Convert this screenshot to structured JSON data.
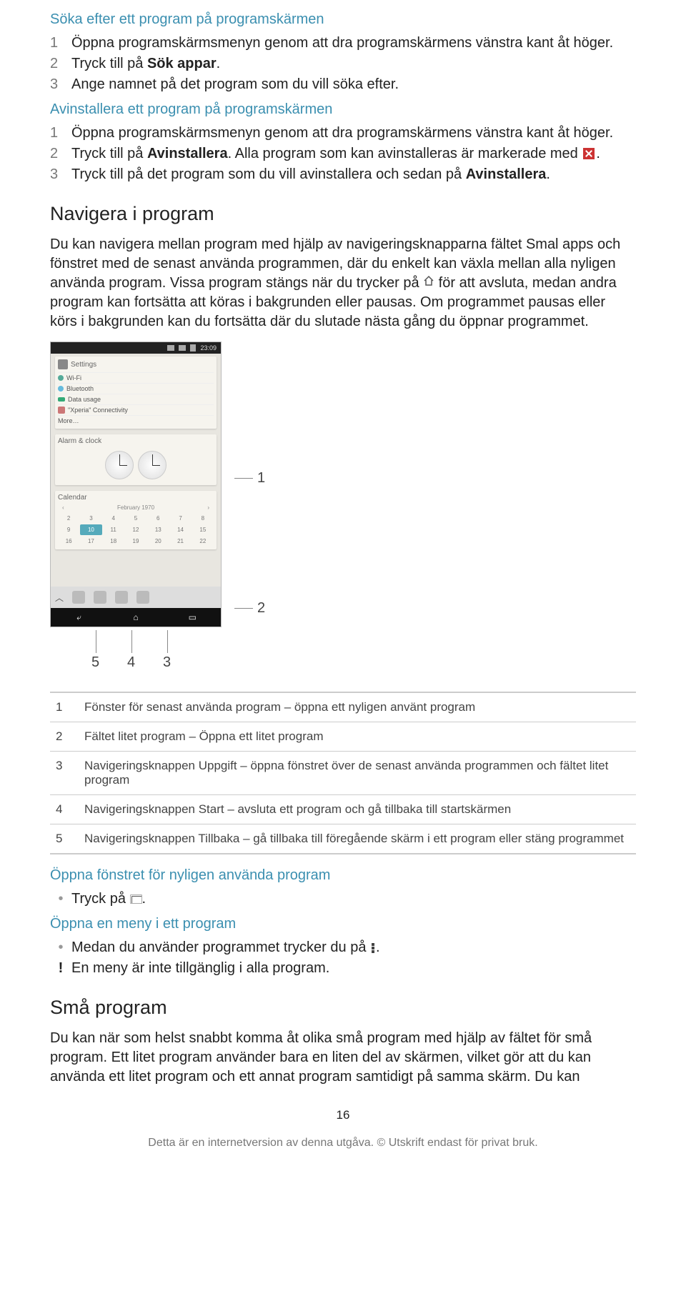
{
  "s1": {
    "title": "Söka efter ett program på programskärmen",
    "steps": [
      {
        "n": "1",
        "parts": [
          "Öppna programskärmsmenyn genom att dra programskärmens vänstra kant åt höger."
        ]
      },
      {
        "n": "2",
        "parts": [
          "Tryck till på "
        ],
        "bold": "Sök appar",
        "tail": "."
      },
      {
        "n": "3",
        "parts": [
          "Ange namnet på det program som du vill söka efter."
        ]
      }
    ]
  },
  "s2": {
    "title": "Avinstallera ett program på programskärmen",
    "steps": [
      {
        "n": "1",
        "parts": [
          "Öppna programskärmsmenyn genom att dra programskärmens vänstra kant åt höger."
        ]
      },
      {
        "n": "2",
        "parts": [
          "Tryck till på "
        ],
        "bold": "Avinstallera",
        "tail": ". Alla program som kan avinstalleras är markerade med ",
        "iconAfter": "x",
        "trail": "."
      },
      {
        "n": "3",
        "parts": [
          "Tryck till på det program som du vill avinstallera och sedan på "
        ],
        "bold": "Avinstallera",
        "tail": "."
      }
    ]
  },
  "nav": {
    "heading": "Navigera i program",
    "p_before": "Du kan navigera mellan program med hjälp av navigeringsknapparna fältet Smal apps och fönstret med de senast använda programmen, där du enkelt kan växla mellan alla nyligen använda program. Vissa program stängs när du trycker på ",
    "p_after": " för att avsluta, medan andra program kan fortsätta att köras i bakgrunden eller pausas. Om programmet pausas eller körs i bakgrunden kan du fortsätta där du slutade nästa gång du öppnar programmet."
  },
  "shot": {
    "time": "23:09",
    "settings": "Settings",
    "rows": {
      "wifi": "Wi-Fi",
      "bt": "Bluetooth",
      "data": "Data usage",
      "xc": "\"Xperia\" Connectivity",
      "more": "More…"
    },
    "alarm": "Alarm & clock",
    "cal": "Calendar",
    "month": "February 1970",
    "days": [
      "2",
      "3",
      "4",
      "5",
      "6",
      "7",
      "8",
      "9",
      "10",
      "11",
      "12",
      "13",
      "14",
      "15",
      "16",
      "17",
      "18",
      "19",
      "20",
      "21",
      "22"
    ],
    "callouts": {
      "c1": "1",
      "c2": "2",
      "c3": "3",
      "c4": "4",
      "c5": "5"
    }
  },
  "legend": [
    {
      "n": "1",
      "t": "Fönster för senast använda program – öppna ett nyligen använt program"
    },
    {
      "n": "2",
      "t": "Fältet litet program – Öppna ett litet program"
    },
    {
      "n": "3",
      "t": "Navigeringsknappen Uppgift – öppna fönstret över de senast använda programmen och fältet litet program"
    },
    {
      "n": "4",
      "t": "Navigeringsknappen Start – avsluta ett program och gå tillbaka till startskärmen"
    },
    {
      "n": "5",
      "t": "Navigeringsknappen Tillbaka – gå tillbaka till föregående skärm i ett program eller stäng programmet"
    }
  ],
  "open_recent": {
    "title": "Öppna fönstret för nyligen använda program",
    "text_before": "Tryck på ",
    "text_after": "."
  },
  "open_menu": {
    "title": "Öppna en meny i ett program",
    "line1_before": "Medan du använder programmet trycker du på ",
    "line1_after": ".",
    "line2": "En meny är inte tillgänglig i alla program."
  },
  "small": {
    "heading": "Små program",
    "para": "Du kan när som helst snabbt komma åt olika små program med hjälp av fältet för små program. Ett litet program använder bara en liten del av skärmen, vilket gör att du kan använda ett litet program och ett annat program samtidigt på samma skärm. Du kan"
  },
  "pagenum": "16",
  "footer": "Detta är en internetversion av denna utgåva. © Utskrift endast för privat bruk."
}
